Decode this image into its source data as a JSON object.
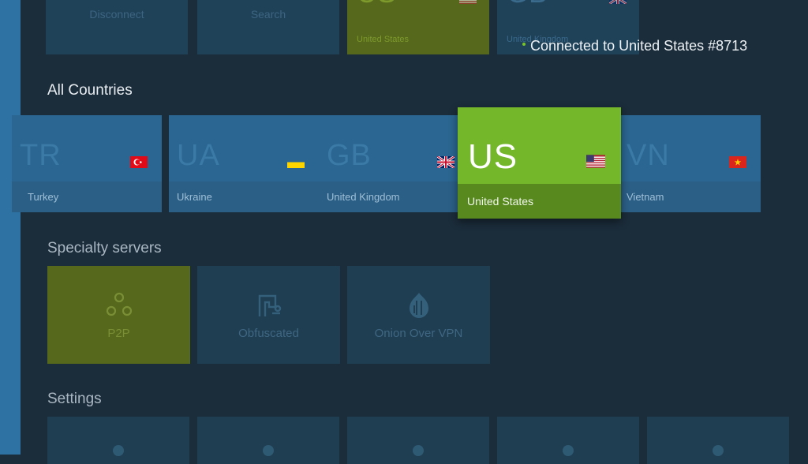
{
  "top_row": {
    "tiles": [
      {
        "label": "Disconnect",
        "icon": "cursor-icon"
      },
      {
        "label": "Search",
        "icon": "search-icon"
      }
    ],
    "countries": [
      {
        "code": "US",
        "name": "United States"
      },
      {
        "code": "GB",
        "name": "United Kingdom"
      }
    ]
  },
  "status": {
    "text": "Connected to United States #8713",
    "color": "#79c52a"
  },
  "all_countries": {
    "title": "All Countries",
    "items": [
      {
        "code": "TR",
        "name": "Turkey",
        "flag": "turkey-flag-icon"
      },
      {
        "code": "UA",
        "name": "Ukraine",
        "flag": "ukraine-flag-icon"
      },
      {
        "code": "GB",
        "name": "United Kingdom",
        "flag": "uk-flag-icon"
      },
      {
        "code": "US",
        "name": "United States",
        "flag": "us-flag-icon",
        "selected": true
      },
      {
        "code": "VN",
        "name": "Vietnam",
        "flag": "vietnam-flag-icon"
      }
    ]
  },
  "specialty": {
    "title": "Specialty servers",
    "items": [
      {
        "label": "P2P",
        "icon": "p2p-icon"
      },
      {
        "label": "Obfuscated",
        "icon": "obfuscated-icon"
      },
      {
        "label": "Onion Over VPN",
        "icon": "onion-icon"
      }
    ]
  },
  "settings": {
    "title": "Settings"
  },
  "colors": {
    "background": "#1b2c3a",
    "tile": "#2a6691",
    "selected": "#74b72a",
    "accent_rail": "#2e72a3"
  }
}
